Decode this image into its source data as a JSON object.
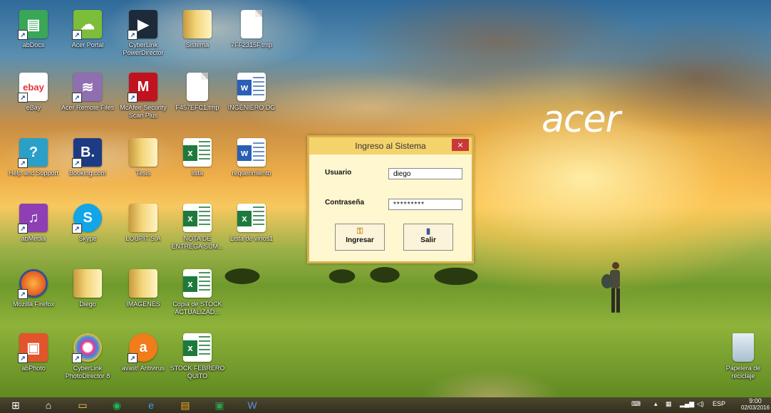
{
  "desktop": {
    "brand": "acer",
    "icons": [
      {
        "label": "abDocs"
      },
      {
        "label": "Acer Portal"
      },
      {
        "label": "CyberLink PowerDirector"
      },
      {
        "label": "Sistema"
      },
      {
        "label": "7FF2315F.tmp"
      },
      {
        "label": "eBay"
      },
      {
        "label": "Acer Remote Files"
      },
      {
        "label": "McAfee Security Scan Plus"
      },
      {
        "label": "F457EFC1.tmp"
      },
      {
        "label": "INGENIERO DG"
      },
      {
        "label": "Help and Support"
      },
      {
        "label": "Booking.com"
      },
      {
        "label": "Tesis"
      },
      {
        "label": "lista"
      },
      {
        "label": "requerimiento"
      },
      {
        "label": "abMedia"
      },
      {
        "label": "Skype"
      },
      {
        "label": "LOUPIT S.A"
      },
      {
        "label": "NOTA DE ENTREGA SUM..."
      },
      {
        "label": "Lista de vinos1"
      },
      {
        "label": "Mozilla Firefox"
      },
      {
        "label": "Diego"
      },
      {
        "label": "IMAGENES"
      },
      {
        "label": "Copia de STOCK ACTUALIZAD..."
      },
      {
        "label": "abPhoto"
      },
      {
        "label": "CyberLink PhotoDirector 8"
      },
      {
        "label": "avast! Antivirus"
      },
      {
        "label": "STOCK FEBRERO QUITO"
      },
      {
        "label": "Papelera de reciclaje"
      }
    ]
  },
  "dialog": {
    "title": "Ingreso al Sistema",
    "close": "×",
    "user_label": "Usuario",
    "user_value": "diego",
    "password_label": "Contraseña",
    "password_value": "*********",
    "login_button": "Ingresar",
    "exit_button": "Salir"
  },
  "taskbar": {
    "items": [
      "start-icon",
      "home-icon",
      "file-explorer-icon",
      "spotify-icon",
      "internet-explorer-icon",
      "store-icon",
      "windows-store-icon",
      "word-icon"
    ],
    "language": "ESP",
    "time": "9:00",
    "date": "02/03/2016"
  }
}
